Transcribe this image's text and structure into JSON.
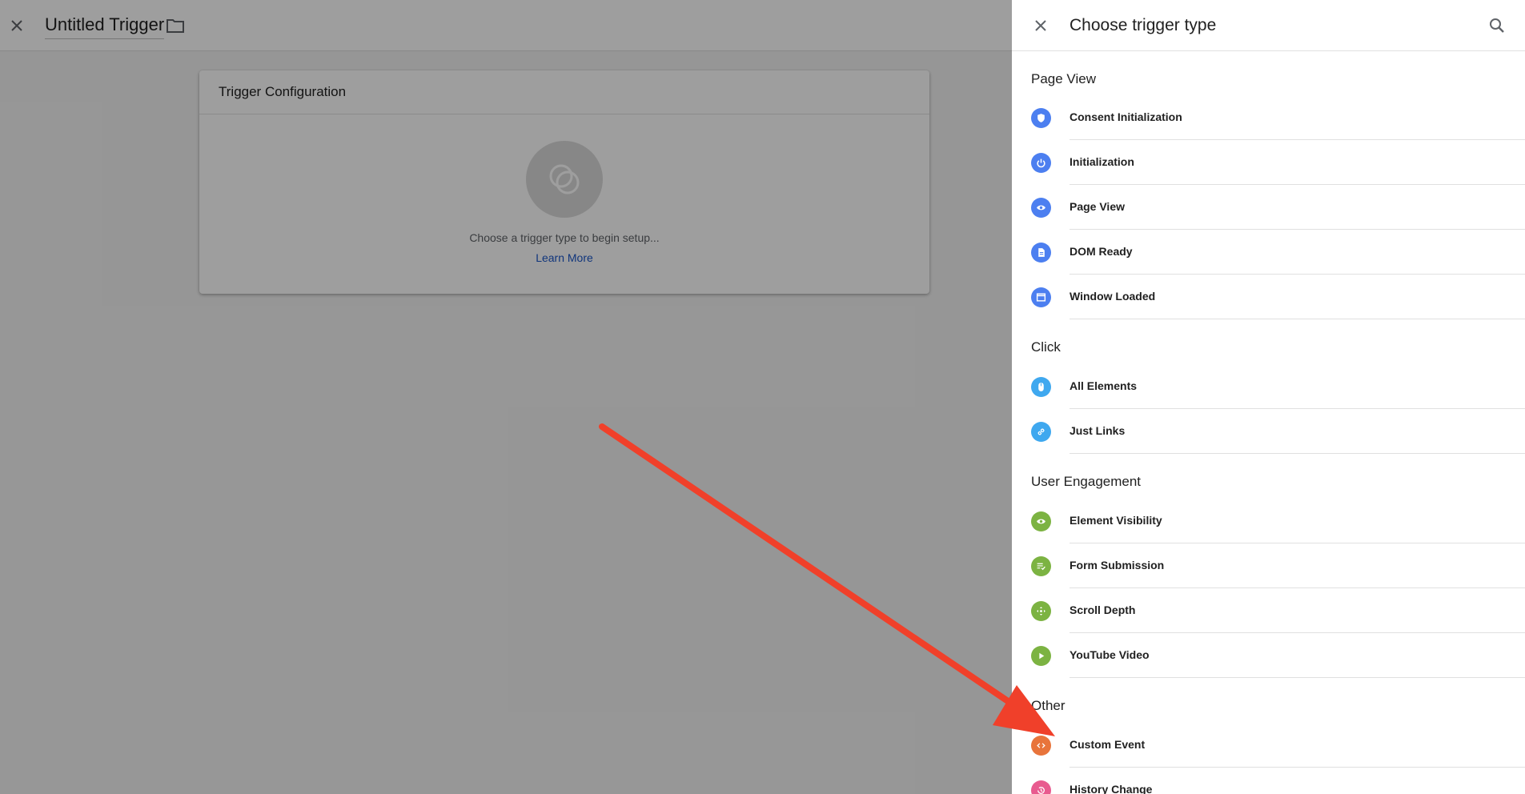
{
  "background": {
    "title": "Untitled Trigger",
    "config_card": {
      "heading": "Trigger Configuration",
      "hint": "Choose a trigger type to begin setup...",
      "learn_more": "Learn More"
    }
  },
  "panel": {
    "title": "Choose trigger type",
    "sections": [
      {
        "title": "Page View",
        "items": [
          {
            "label": "Consent Initialization",
            "icon": "shield-icon",
            "color": "#4c7ff0"
          },
          {
            "label": "Initialization",
            "icon": "power-icon",
            "color": "#4c7ff0"
          },
          {
            "label": "Page View",
            "icon": "eye-icon",
            "color": "#4c7ff0"
          },
          {
            "label": "DOM Ready",
            "icon": "document-icon",
            "color": "#4c7ff0"
          },
          {
            "label": "Window Loaded",
            "icon": "window-icon",
            "color": "#4c7ff0"
          }
        ]
      },
      {
        "title": "Click",
        "items": [
          {
            "label": "All Elements",
            "icon": "mouse-icon",
            "color": "#3fa8ef"
          },
          {
            "label": "Just Links",
            "icon": "link-icon",
            "color": "#3fa8ef"
          }
        ]
      },
      {
        "title": "User Engagement",
        "items": [
          {
            "label": "Element Visibility",
            "icon": "eye-icon",
            "color": "#7cb342"
          },
          {
            "label": "Form Submission",
            "icon": "form-check-icon",
            "color": "#7cb342"
          },
          {
            "label": "Scroll Depth",
            "icon": "move-icon",
            "color": "#7cb342"
          },
          {
            "label": "YouTube Video",
            "icon": "play-icon",
            "color": "#7cb342"
          }
        ]
      },
      {
        "title": "Other",
        "items": [
          {
            "label": "Custom Event",
            "icon": "code-icon",
            "color": "#e8743b"
          },
          {
            "label": "History Change",
            "icon": "history-icon",
            "color": "#e85b8f"
          }
        ]
      }
    ]
  },
  "annotation": {
    "arrow_color": "#f0402a"
  }
}
